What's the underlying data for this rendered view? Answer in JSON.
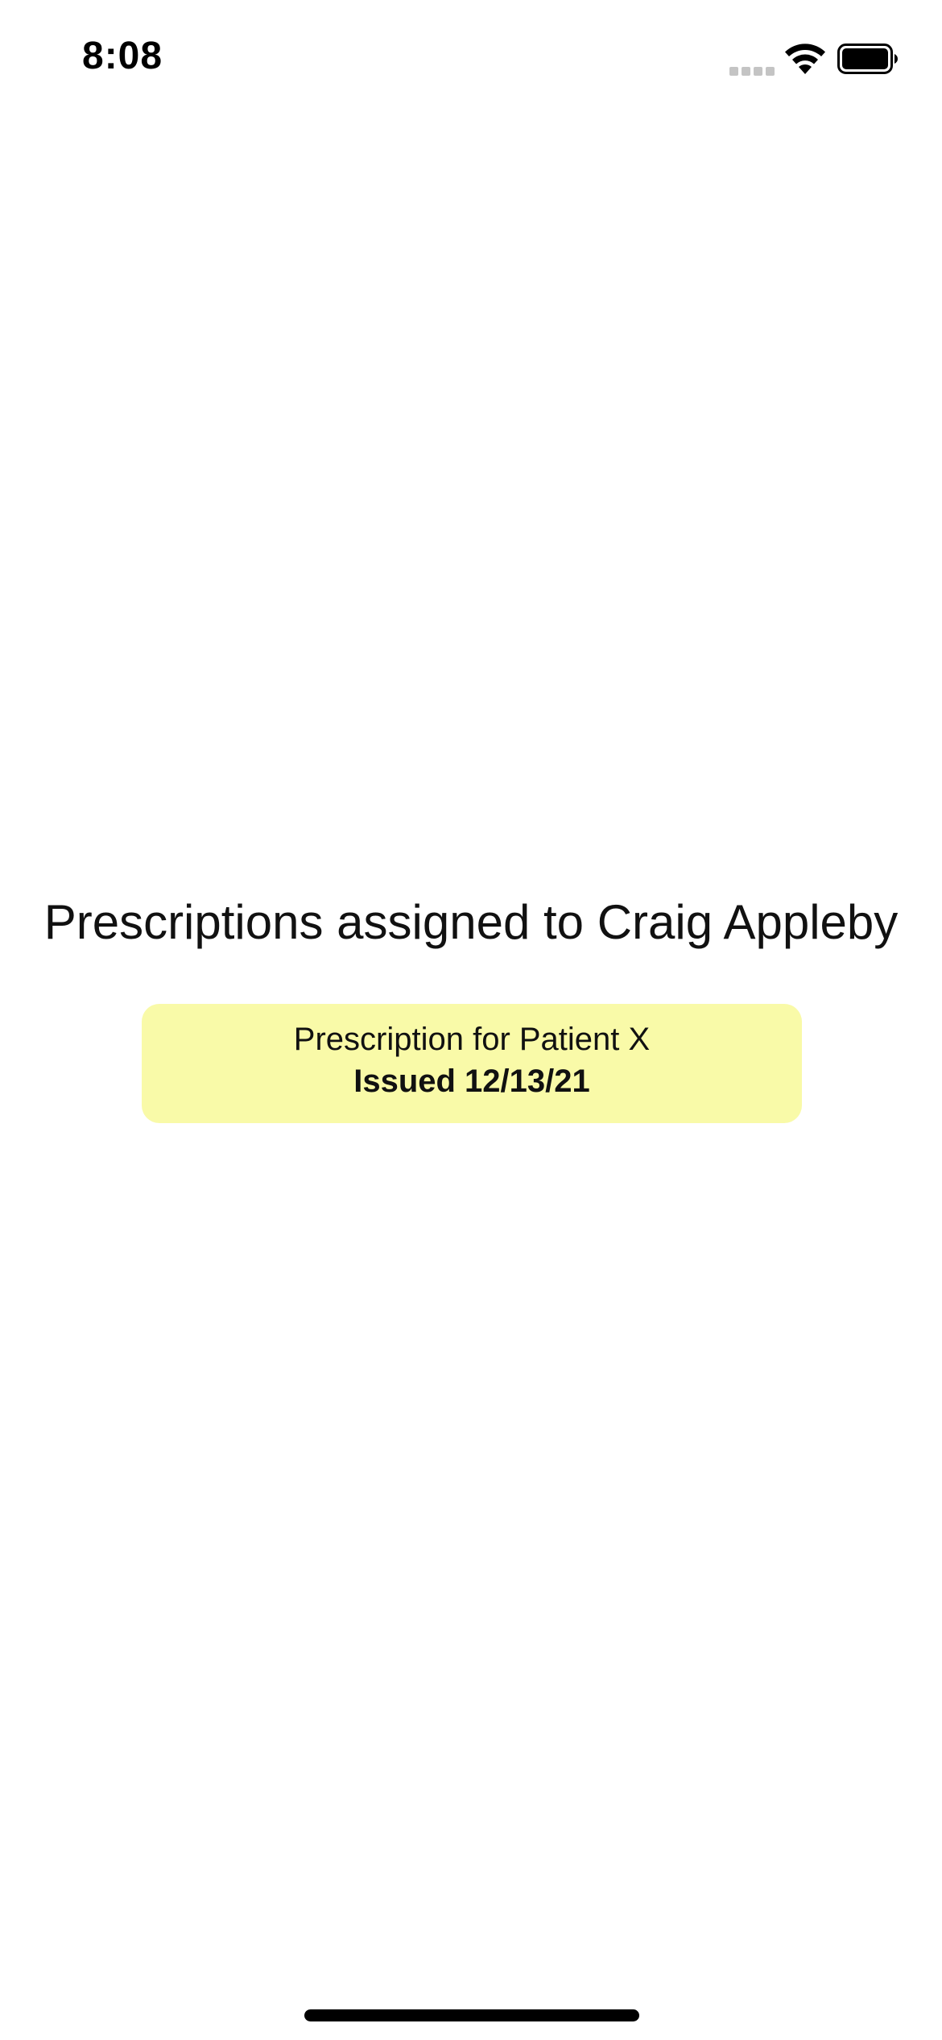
{
  "status_bar": {
    "time": "8:08",
    "icons": [
      "cellular-signal-icon",
      "wifi-icon",
      "battery-icon"
    ]
  },
  "page": {
    "heading": "Prescriptions assigned to Craig Appleby"
  },
  "prescriptions": [
    {
      "title": "Prescription for Patient X",
      "issued": "Issued 12/13/21"
    }
  ],
  "colors": {
    "card_background": "#f9faa8",
    "background": "#ffffff",
    "text": "#111111"
  }
}
